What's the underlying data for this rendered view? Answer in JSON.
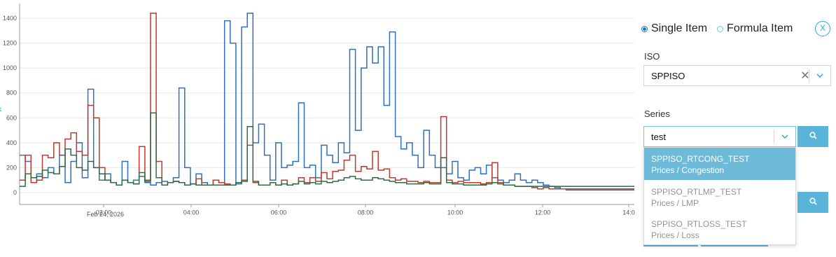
{
  "chart": {
    "y_ticks": [
      "0",
      "200",
      "400",
      "600",
      "800",
      "1000",
      "1200",
      "1400"
    ],
    "x_ticks": [
      "02:00",
      "04:00",
      "06:00",
      "08:00",
      "10:00",
      "12:00",
      "14:0"
    ],
    "date_label": "Feb 24, 2026"
  },
  "chart_data": {
    "type": "line",
    "ylim": [
      0,
      1400
    ],
    "series": [
      {
        "color": "#2f6fbd",
        "values": [
          300,
          250,
          80,
          150,
          120,
          200,
          150,
          300,
          80,
          250,
          400,
          120,
          830,
          200,
          100,
          150,
          80,
          60,
          250,
          80,
          100,
          130,
          80,
          60,
          80,
          90,
          80,
          120,
          840,
          200,
          70,
          150,
          80,
          60,
          100,
          80,
          1380,
          1200,
          70,
          1330,
          1440,
          400,
          550,
          300,
          100,
          400,
          200,
          220,
          250,
          720,
          200,
          220,
          120,
          380,
          300,
          240,
          400,
          320,
          1150,
          500,
          1000,
          1170,
          1040,
          1170,
          700,
          1290,
          450,
          350,
          400,
          300,
          200,
          500,
          300,
          200,
          200,
          150,
          250,
          120,
          100,
          180,
          200,
          150,
          220,
          120,
          100,
          80,
          100,
          150,
          100,
          80,
          100,
          80,
          60,
          50,
          40,
          30,
          20,
          20,
          20,
          20,
          20,
          20,
          20,
          20,
          20,
          20,
          20,
          20
        ]
      },
      {
        "color": "#c0392b",
        "values": [
          100,
          300,
          80,
          100,
          300,
          280,
          400,
          300,
          430,
          480,
          330,
          300,
          700,
          600,
          200,
          100,
          80,
          60,
          100,
          80,
          70,
          370,
          100,
          1440,
          250,
          60,
          80,
          90,
          80,
          60,
          70,
          110,
          60,
          60,
          100,
          80,
          70,
          60,
          80,
          100,
          380,
          80,
          60,
          60,
          80,
          60,
          100,
          60,
          70,
          120,
          80,
          120,
          90,
          160,
          110,
          170,
          180,
          260,
          300,
          170,
          210,
          190,
          330,
          180,
          190,
          120,
          100,
          110,
          90,
          90,
          80,
          90,
          80,
          80,
          610,
          100,
          80,
          90,
          80,
          80,
          80,
          70,
          80,
          240,
          80,
          60,
          60,
          50,
          50,
          50,
          40,
          30,
          40,
          30,
          30,
          30,
          30,
          30,
          30,
          30,
          30,
          30,
          30,
          30,
          30,
          30,
          30,
          30
        ]
      },
      {
        "color": "#2e6b45",
        "values": [
          50,
          150,
          120,
          130,
          180,
          160,
          150,
          210,
          350,
          300,
          200,
          180,
          250,
          200,
          150,
          100,
          80,
          60,
          100,
          80,
          70,
          160,
          90,
          640,
          120,
          60,
          80,
          90,
          80,
          60,
          70,
          60,
          60,
          60,
          60,
          60,
          60,
          60,
          80,
          90,
          530,
          90,
          60,
          60,
          80,
          60,
          70,
          60,
          70,
          90,
          70,
          80,
          70,
          90,
          80,
          90,
          100,
          120,
          130,
          110,
          100,
          100,
          120,
          110,
          100,
          90,
          80,
          80,
          70,
          70,
          70,
          80,
          70,
          70,
          280,
          80,
          70,
          70,
          60,
          60,
          60,
          60,
          70,
          80,
          70,
          60,
          60,
          50,
          50,
          50,
          50,
          50,
          50,
          50,
          50,
          50,
          50,
          50,
          50,
          50,
          50,
          50,
          50,
          50,
          50,
          50,
          50,
          50
        ]
      }
    ]
  },
  "panel": {
    "radio_single": "Single Item",
    "radio_formula": "Formula Item",
    "close": "X",
    "iso_label": "ISO",
    "iso_value": "SPPISO",
    "clear_icon": "✕",
    "series_label": "Series",
    "series_value": "test",
    "chevron": "⌄",
    "search_icon": "⚲",
    "options": [
      {
        "name": "SPPISO_RTCONG_TEST",
        "desc": "Prices / Congestion"
      },
      {
        "name": "SPPISO_RTLMP_TEST",
        "desc": "Prices / LMP"
      },
      {
        "name": "SPPISO_RTLOSS_TEST",
        "desc": "Prices / Loss"
      }
    ]
  }
}
